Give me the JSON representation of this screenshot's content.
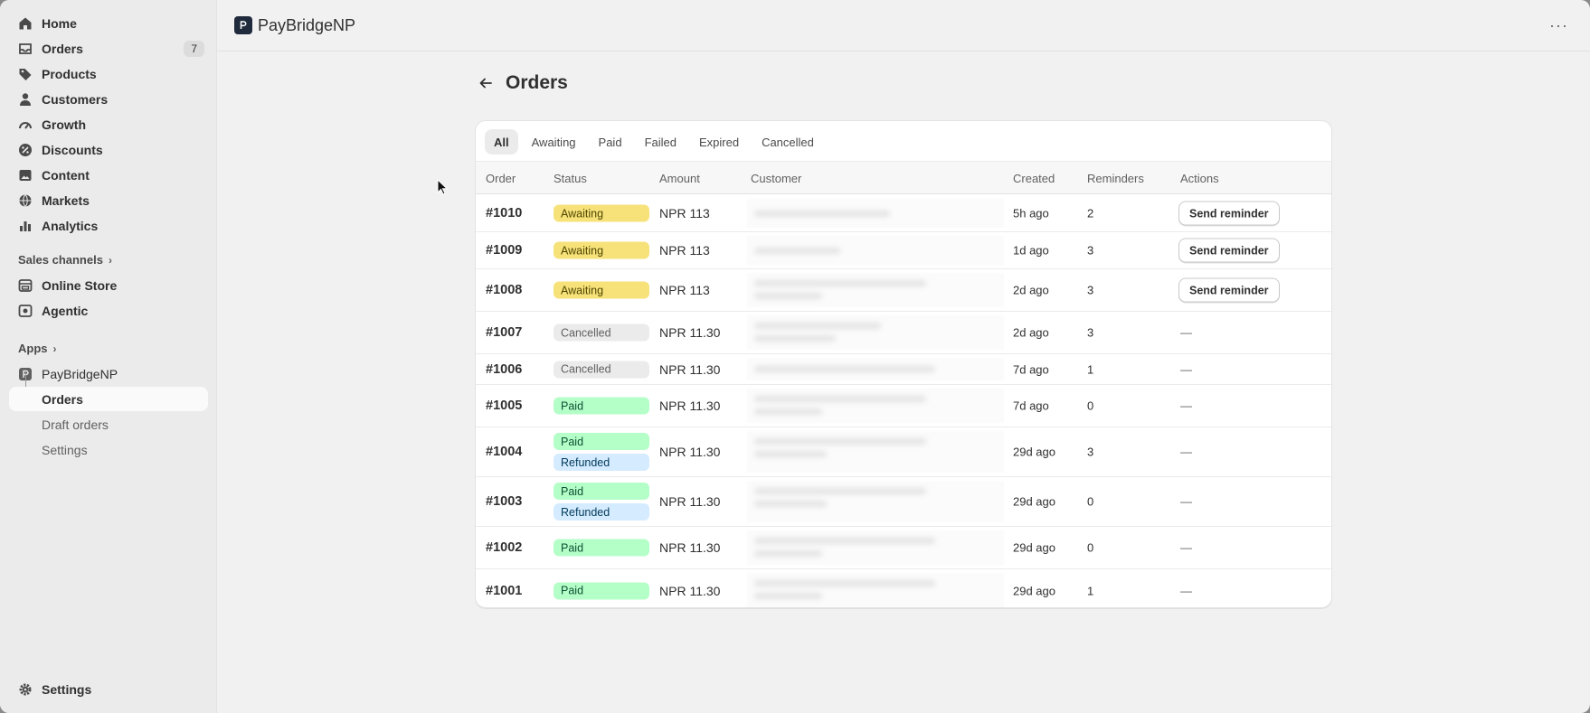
{
  "sidebar": {
    "items": [
      {
        "label": "Home",
        "icon": "home-icon"
      },
      {
        "label": "Orders",
        "icon": "orders-icon",
        "count": "7"
      },
      {
        "label": "Products",
        "icon": "tag-icon"
      },
      {
        "label": "Customers",
        "icon": "person-icon"
      },
      {
        "label": "Growth",
        "icon": "gauge-icon"
      },
      {
        "label": "Discounts",
        "icon": "discount-icon"
      },
      {
        "label": "Content",
        "icon": "image-icon"
      },
      {
        "label": "Markets",
        "icon": "globe-icon"
      },
      {
        "label": "Analytics",
        "icon": "bar-chart-icon"
      }
    ],
    "sales_channels_label": "Sales channels",
    "channels": [
      {
        "label": "Online Store",
        "icon": "store-icon"
      },
      {
        "label": "Agentic",
        "icon": "agent-icon"
      }
    ],
    "apps_label": "Apps",
    "app": {
      "label": "PayBridgeNP",
      "icon": "app-icon"
    },
    "app_subitems": [
      "Orders",
      "Draft orders",
      "Settings"
    ],
    "settings_label": "Settings"
  },
  "topbar": {
    "title": "PayBridgeNP",
    "more": "···"
  },
  "page": {
    "title": "Orders"
  },
  "tabs": [
    "All",
    "Awaiting",
    "Paid",
    "Failed",
    "Expired",
    "Cancelled"
  ],
  "table": {
    "headers": [
      "Order",
      "Status",
      "Amount",
      "Customer",
      "Created",
      "Reminders",
      "Actions"
    ],
    "action_label": "Send reminder",
    "dash": "—",
    "rows": [
      {
        "id": "#1010",
        "statuses": [
          "Awaiting"
        ],
        "amount": "NPR 113",
        "created": "5h ago",
        "reminders": "2",
        "action": true
      },
      {
        "id": "#1009",
        "statuses": [
          "Awaiting"
        ],
        "amount": "NPR 113",
        "created": "1d ago",
        "reminders": "3",
        "action": true
      },
      {
        "id": "#1008",
        "statuses": [
          "Awaiting"
        ],
        "amount": "NPR 113",
        "created": "2d ago",
        "reminders": "3",
        "action": true
      },
      {
        "id": "#1007",
        "statuses": [
          "Cancelled"
        ],
        "amount": "NPR 11.30",
        "created": "2d ago",
        "reminders": "3",
        "action": false
      },
      {
        "id": "#1006",
        "statuses": [
          "Cancelled"
        ],
        "amount": "NPR 11.30",
        "created": "7d ago",
        "reminders": "1",
        "action": false
      },
      {
        "id": "#1005",
        "statuses": [
          "Paid"
        ],
        "amount": "NPR 11.30",
        "created": "7d ago",
        "reminders": "0",
        "action": false
      },
      {
        "id": "#1004",
        "statuses": [
          "Paid",
          "Refunded"
        ],
        "amount": "NPR 11.30",
        "created": "29d ago",
        "reminders": "3",
        "action": false
      },
      {
        "id": "#1003",
        "statuses": [
          "Paid",
          "Refunded"
        ],
        "amount": "NPR 11.30",
        "created": "29d ago",
        "reminders": "0",
        "action": false
      },
      {
        "id": "#1002",
        "statuses": [
          "Paid"
        ],
        "amount": "NPR 11.30",
        "created": "29d ago",
        "reminders": "0",
        "action": false
      },
      {
        "id": "#1001",
        "statuses": [
          "Paid"
        ],
        "amount": "NPR 11.30",
        "created": "29d ago",
        "reminders": "1",
        "action": false
      }
    ]
  }
}
